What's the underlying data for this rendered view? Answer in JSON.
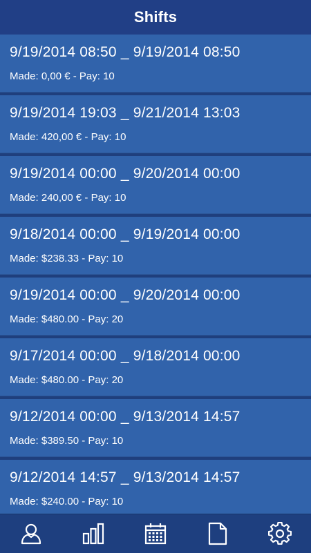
{
  "header": {
    "title": "Shifts"
  },
  "shifts": [
    {
      "range": "9/19/2014 08:50 _ 9/19/2014 08:50",
      "sub": "Made: 0,00 € - Pay: 10"
    },
    {
      "range": "9/19/2014 19:03 _ 9/21/2014 13:03",
      "sub": "Made: 420,00 € - Pay: 10"
    },
    {
      "range": "9/19/2014 00:00 _ 9/20/2014 00:00",
      "sub": "Made: 240,00 € - Pay: 10"
    },
    {
      "range": "9/18/2014 00:00 _ 9/19/2014 00:00",
      "sub": "Made: $238.33 - Pay: 10"
    },
    {
      "range": "9/19/2014 00:00 _ 9/20/2014 00:00",
      "sub": "Made: $480.00 - Pay: 20"
    },
    {
      "range": "9/17/2014 00:00 _ 9/18/2014 00:00",
      "sub": "Made: $480.00 - Pay: 20"
    },
    {
      "range": "9/12/2014 00:00 _ 9/13/2014 14:57",
      "sub": "Made: $389.50 - Pay: 10"
    },
    {
      "range": "9/12/2014 14:57 _ 9/13/2014 14:57",
      "sub": "Made: $240.00 - Pay: 10"
    }
  ],
  "tabbar": {
    "icons": [
      "person-icon",
      "bar-chart-icon",
      "calendar-icon",
      "document-icon",
      "gear-icon"
    ]
  }
}
